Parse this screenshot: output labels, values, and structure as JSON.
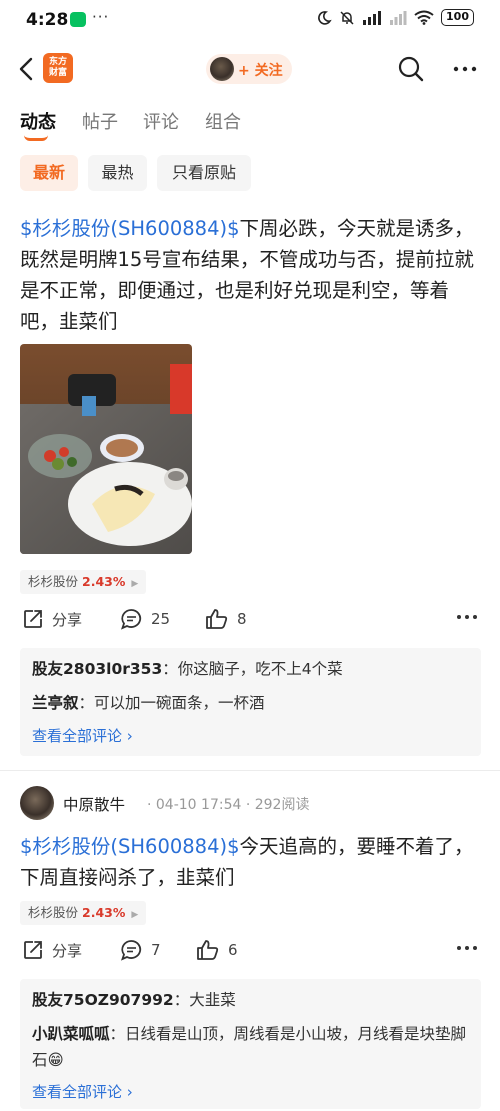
{
  "status_bar": {
    "time": "4:28",
    "dots": "···",
    "battery": "100"
  },
  "nav": {
    "logo_text_1": "东方",
    "logo_text_2": "财富",
    "follow_label": "+ 关注"
  },
  "tabs": [
    {
      "label": "动态",
      "active": true
    },
    {
      "label": "帖子",
      "active": false
    },
    {
      "label": "评论",
      "active": false
    },
    {
      "label": "组合",
      "active": false
    }
  ],
  "filters": [
    {
      "label": "最新",
      "active": true
    },
    {
      "label": "最热",
      "active": false
    },
    {
      "label": "只看原贴",
      "active": false
    }
  ],
  "posts": [
    {
      "stock_link": "$杉杉股份(SH600884)$",
      "body": "下周必跌，今天就是诱多，既然是明牌15号宣布结果，不管成功与否，提前拉就是不正常，即便通过，也是利好兑现是利空，等着吧，韭菜们",
      "tag_name": "杉杉股份",
      "tag_pct": "2.43%",
      "share_label": "分享",
      "comment_count": "25",
      "like_count": "8",
      "comments": [
        {
          "user": "股友2803l0r353",
          "text": "你这脑子，吃不上4个菜"
        },
        {
          "user": "兰亭叙",
          "text": "可以加一碗面条，一杯酒"
        }
      ],
      "view_all": "查看全部评论"
    },
    {
      "author": "中原散牛",
      "meta": "· 04-10 17:54 · 292阅读",
      "stock_link": "$杉杉股份(SH600884)$",
      "body": "今天追高的，要睡不着了，下周直接闷杀了，韭菜们",
      "tag_name": "杉杉股份",
      "tag_pct": "2.43%",
      "share_label": "分享",
      "comment_count": "7",
      "like_count": "6",
      "comments": [
        {
          "user": "股友75OZ907992",
          "text": "大韭菜"
        },
        {
          "user": "小趴菜呱呱",
          "text": "日线看是山顶，周线看是小山坡，月线看是块垫脚石😁"
        }
      ],
      "view_all": "查看全部评论"
    }
  ],
  "colors": {
    "accent": "#f26a22",
    "link": "#2a6fd6",
    "gain": "#d93a2b"
  }
}
